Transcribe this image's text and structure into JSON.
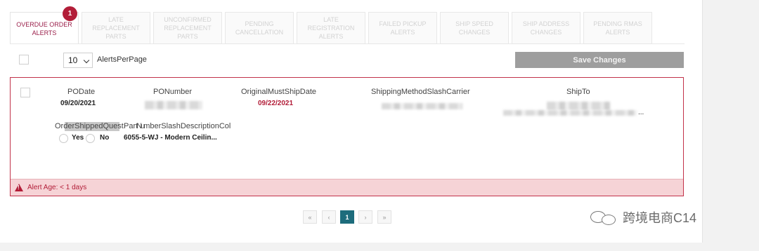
{
  "tabs": [
    {
      "label": "OVERDUE ORDER ALERTS",
      "active": true,
      "badge": "1"
    },
    {
      "label": "LATE REPLACEMENT PARTS"
    },
    {
      "label": "UNCONFIRMED REPLACEMENT PARTS"
    },
    {
      "label": "PENDING CANCELLATION"
    },
    {
      "label": "LATE REGISTRATION ALERTS"
    },
    {
      "label": "FAILED PICKUP ALERTS"
    },
    {
      "label": "SHIP SPEED CHANGES"
    },
    {
      "label": "SHIP ADDRESS CHANGES"
    },
    {
      "label": "PENDING RMAS ALERTS"
    }
  ],
  "controls": {
    "page_size": "10",
    "page_size_label": "AlertsPerPage",
    "save_label": "Save Changes"
  },
  "alert": {
    "headers": {
      "po_date": "PODate",
      "po_number": "PONumber",
      "original_must_ship_date": "OriginalMustShipDate",
      "shipping_method": "ShippingMethodSlashCarrier",
      "ship_to": "ShipTo",
      "order_shipped_question": "OrderShippedQuestionMark",
      "part_number": "PartNumberSlashDescriptionCol"
    },
    "po_date": "09/20/2021",
    "original_must_ship_date": "09/22/2021",
    "ship_to_suffix": "...",
    "order_shipped_question_prefix": "Order",
    "order_shipped_question_highlight": "ShippedQuest",
    "part_number_prefix": "Par",
    "part_number_overlap": "tNu",
    "part_number_suffix": "mberSlashDescriptionCol",
    "radio_yes": "Yes",
    "radio_no": "No",
    "part_number_value": "6055-5-WJ - Modern Ceilin...",
    "age": "Alert Age: < 1 days"
  },
  "pagination": {
    "first": "«",
    "prev": "‹",
    "current": "1",
    "next": "›",
    "last": "»"
  },
  "watermark": "跨境电商C14",
  "colors": {
    "accent": "#b21d38",
    "tab_active": "#9a1f4a",
    "page_active": "#1d6c7c",
    "save_button": "#9e9e9e",
    "age_bar": "#f6d3d6"
  }
}
